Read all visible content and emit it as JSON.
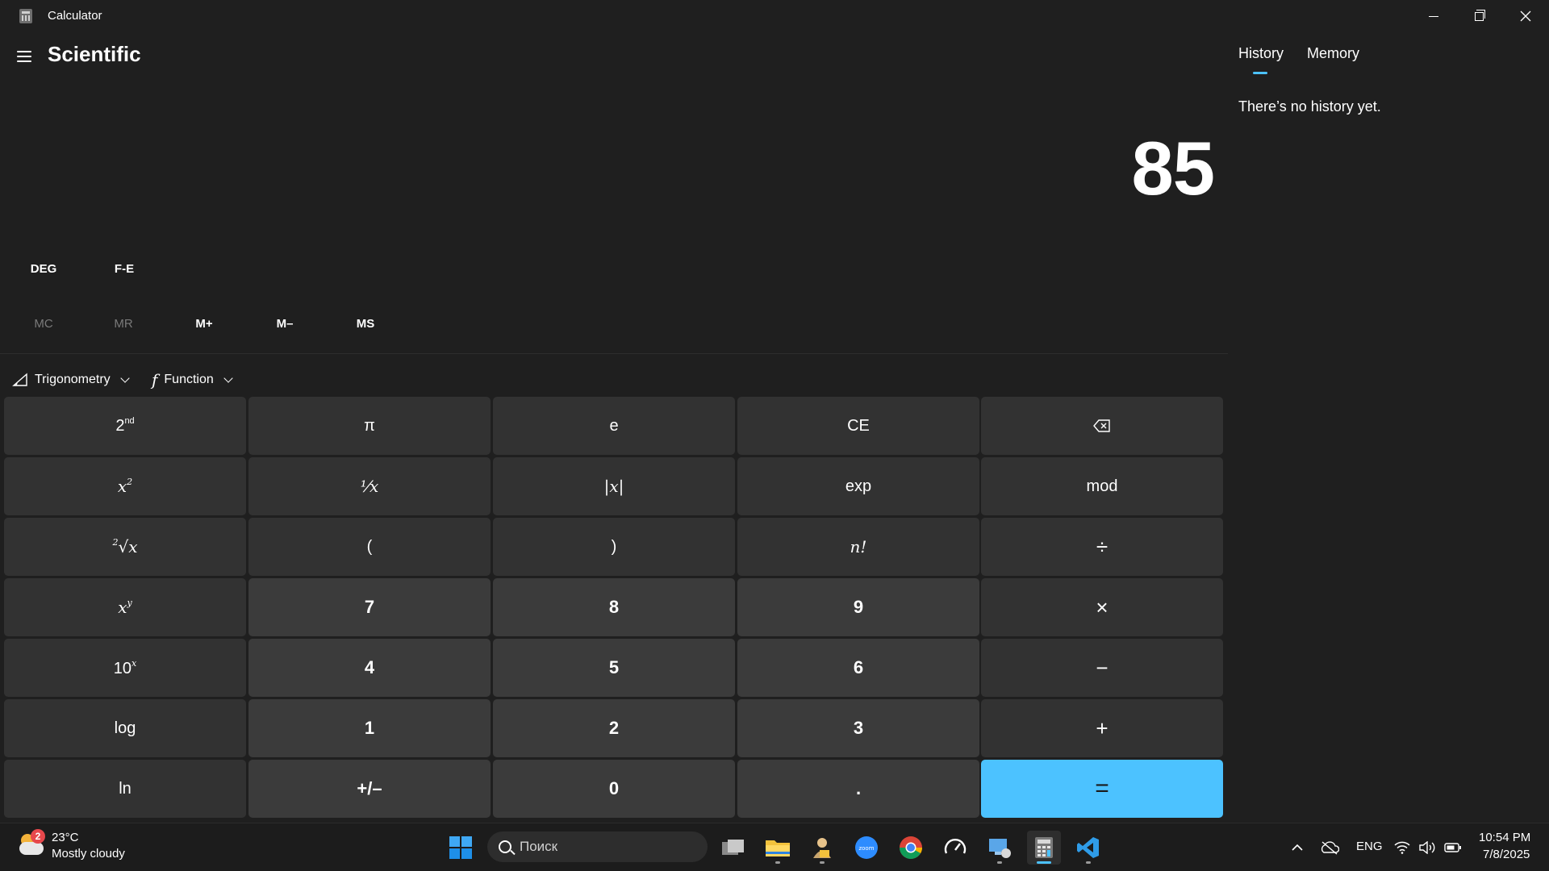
{
  "window": {
    "title": "Calculator",
    "controls": {
      "minimize": "minimize",
      "restore": "restore",
      "close": "close"
    }
  },
  "header": {
    "mode": "Scientific"
  },
  "display": {
    "value": "85"
  },
  "modes": {
    "angle": "DEG",
    "notation": "F-E"
  },
  "memory": {
    "mc": "MC",
    "mr": "MR",
    "mplus": "M+",
    "mminus": "M–",
    "ms": "MS"
  },
  "dropdowns": {
    "trig": "Trigonometry",
    "func": "Function"
  },
  "keys": {
    "pi": "π",
    "e": "e",
    "ce": "CE",
    "abs": "|x|",
    "exp": "exp",
    "mod": "mod",
    "lparen": "(",
    "rparen": ")",
    "fact": "n!",
    "divide": "÷",
    "multiply": "×",
    "minus": "−",
    "plus": "+",
    "equals": "=",
    "n7": "7",
    "n8": "8",
    "n9": "9",
    "n4": "4",
    "n5": "5",
    "n6": "6",
    "n1": "1",
    "n2": "2",
    "n3": "3",
    "n0": "0",
    "decimal": ".",
    "negate": "+/–",
    "log": "log",
    "ln": "ln",
    "recip": "⅟x"
  },
  "history": {
    "tab_history": "History",
    "tab_memory": "Memory",
    "empty": "There’s no history yet."
  },
  "taskbar": {
    "weather_temp": "23°C",
    "weather_desc": "Mostly cloudy",
    "weather_badge": "2",
    "search_placeholder": "Поиск",
    "lang": "ENG",
    "time": "10:54 PM",
    "date": "7/8/2025"
  },
  "colors": {
    "accent": "#4cc2ff",
    "background": "#1f1f1f",
    "key": "#3b3b3b",
    "key_fn": "#323232"
  }
}
